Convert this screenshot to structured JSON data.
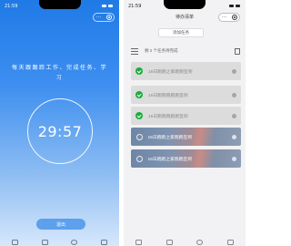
{
  "left_screen": {
    "status_time": "21:59",
    "focus_text": "每天跟跟踪工作、完成任务、学\n习",
    "timer": "29:57",
    "exit_label": "退出"
  },
  "right_screen": {
    "status_time": "21:59",
    "nav_title": "待办清单",
    "add_task_label": "添加任务",
    "summary": "剩 2 个任务待完成",
    "tasks": [
      {
        "text": "16日跑跑之家跑跑签到",
        "done": true
      },
      {
        "text": "16日跑跑跑跑跑签到",
        "done": true
      },
      {
        "text": "16日跑跑跑跑跑签到",
        "done": true
      },
      {
        "text": "16日跑跑之家跑跑签到",
        "done": false
      },
      {
        "text": "16日跑跑之家跑跑签到",
        "done": false
      }
    ]
  },
  "colors": {
    "primary_blue": "#1f7ae6",
    "check_green": "#1aad3c",
    "exit_button": "#5da0ec"
  },
  "icons": {
    "capsule_more": "more-dots-icon",
    "capsule_close": "close-target-icon",
    "list": "list-icon",
    "trash": "trash-icon",
    "check": "check-circle-icon"
  }
}
